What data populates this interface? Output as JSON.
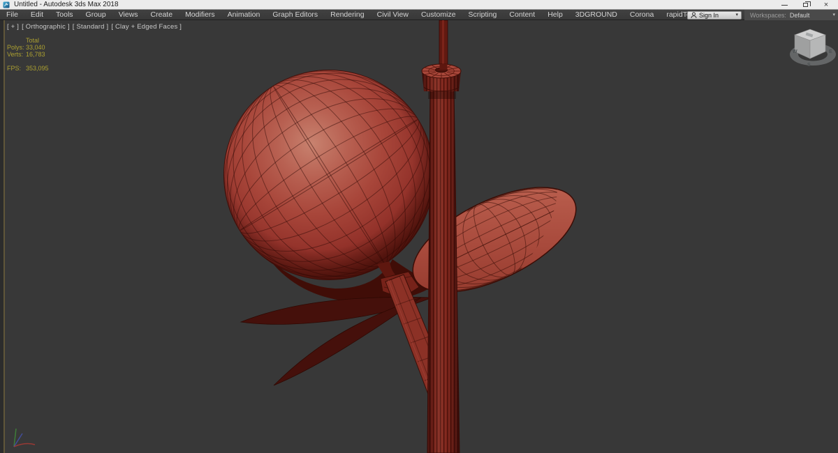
{
  "window": {
    "title": "Untitled - Autodesk 3ds Max 2018",
    "close_glyph": "×"
  },
  "ui": {
    "caret_glyph": "▾"
  },
  "menu": {
    "items": [
      "File",
      "Edit",
      "Tools",
      "Group",
      "Views",
      "Create",
      "Modifiers",
      "Animation",
      "Graph Editors",
      "Rendering",
      "Civil View",
      "Customize",
      "Scripting",
      "Content",
      "Help",
      "3DGROUND",
      "Corona",
      "rapidTools"
    ]
  },
  "account": {
    "sign_in_label": "Sign In"
  },
  "workspaces": {
    "label": "Workspaces:",
    "selected": "Default"
  },
  "viewport": {
    "label_segments": [
      "[ + ]",
      "[ Orthographic ]",
      "[ Standard ]",
      "[ Clay + Edged Faces ]"
    ],
    "stats": {
      "header": "Total",
      "rows": [
        {
          "label": "Polys:",
          "value": "33,040"
        },
        {
          "label": "Verts:",
          "value": "16,783"
        }
      ],
      "fps_label": "FPS:",
      "fps_value": "353,095"
    },
    "viewcube": {
      "letters": {
        "west": "W",
        "south": "S",
        "east": "E"
      }
    },
    "colors": {
      "background": "#383838",
      "model_red": "#a8463a",
      "model_highlight": "#c8826f",
      "model_shadow": "#45100b",
      "wireframe": "#2f0a05",
      "stats_text": "#aca030",
      "active_viewport_border": "#60573a"
    }
  }
}
